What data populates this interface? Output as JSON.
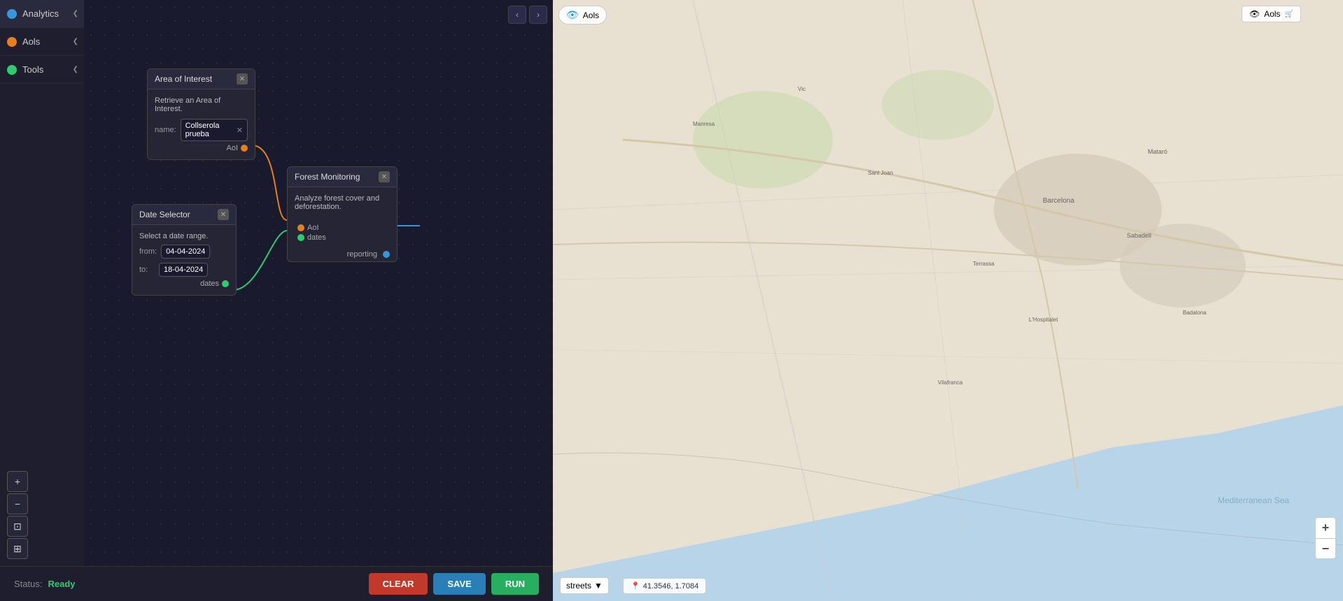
{
  "app": {
    "title": "Analytics"
  },
  "sidebar": {
    "items": [
      {
        "id": "analytics",
        "label": "Analytics",
        "dot_color": "blue",
        "active": true
      },
      {
        "id": "aols",
        "label": "Aols",
        "dot_color": "orange"
      },
      {
        "id": "tools",
        "label": "Tools",
        "dot_color": "green"
      }
    ]
  },
  "canvas": {
    "collapse_left_label": "<",
    "collapse_right_label": ">"
  },
  "nodes": {
    "aoi": {
      "title": "Area of Interest",
      "description": "Retrieve an Area of Interest.",
      "name_label": "name:",
      "name_value": "Collserola prueba",
      "output_label": "AoI"
    },
    "date_selector": {
      "title": "Date Selector",
      "description": "Select a date range.",
      "from_label": "from:",
      "from_value": "04-04-2024",
      "to_label": "to:",
      "to_value": "18-04-2024",
      "output_label": "dates"
    },
    "forest_monitoring": {
      "title": "Forest Monitoring",
      "description": "Analyze forest cover and deforestation.",
      "input_aoi_label": "AoI",
      "input_dates_label": "dates",
      "output_label": "reporting"
    }
  },
  "status": {
    "label": "Status:",
    "value": "Ready"
  },
  "buttons": {
    "clear": "CLEAR",
    "save": "SAVE",
    "run": "RUN"
  },
  "map": {
    "layer_label": "Aols",
    "style_label": "streets",
    "coords": "41.3546, 1.7084"
  },
  "canvas_controls": {
    "zoom_in": "+",
    "zoom_out": "−",
    "fit": "⊡",
    "layers": "⊞"
  }
}
